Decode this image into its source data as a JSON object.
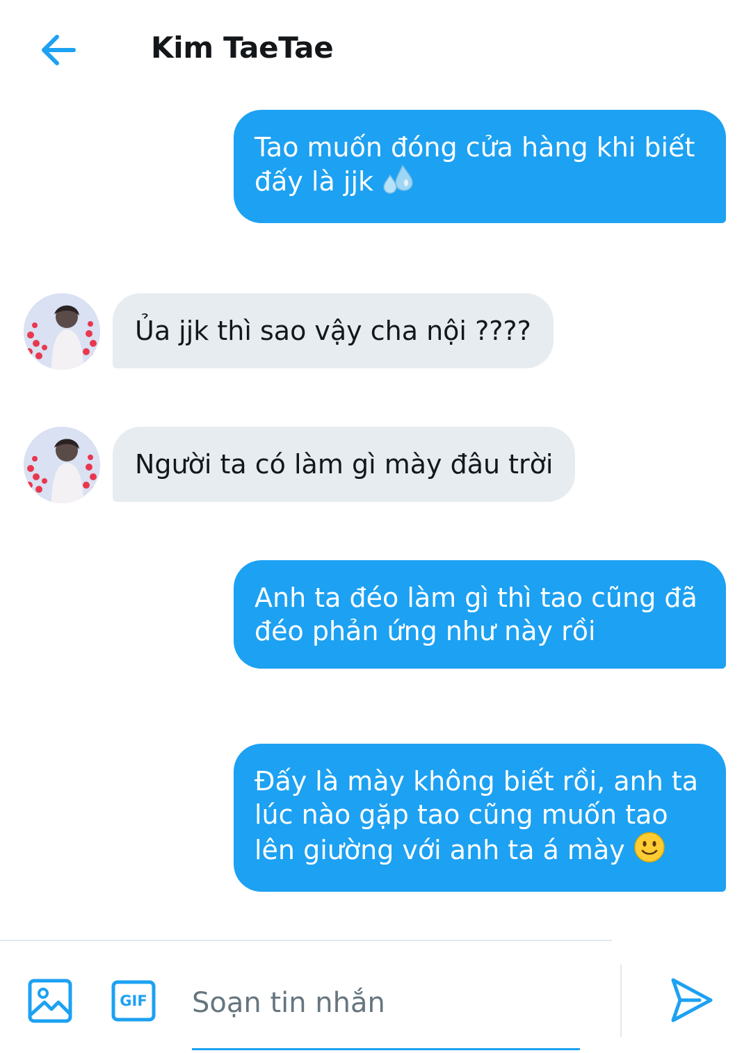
{
  "header": {
    "title": "Kim TaeTae"
  },
  "messages": [
    {
      "direction": "sent",
      "text": "Tao muốn đóng cửa hàng khi biết đấy là jjk",
      "emoji": "sweat-droplets"
    },
    {
      "direction": "received",
      "text": "Ủa jjk thì sao vậy cha nội ????"
    },
    {
      "direction": "received",
      "text": "Người ta có làm gì mày đâu trời"
    },
    {
      "direction": "sent",
      "text": "Anh ta đéo làm gì thì tao cũng đã đéo phản ứng như này rồi"
    },
    {
      "direction": "sent",
      "text": "Đấy là mày không biết rồi, anh ta lúc nào gặp tao cũng muốn tao lên giường với anh ta á mày",
      "emoji": "slightly-smiling-face"
    }
  ],
  "composer": {
    "placeholder": "Soạn tin nhắn",
    "gif_label": "GIF"
  },
  "colors": {
    "accent": "#1da1f2",
    "received_bubble": "#e6ecf0",
    "text": "#14171a",
    "placeholder": "#66757f"
  }
}
